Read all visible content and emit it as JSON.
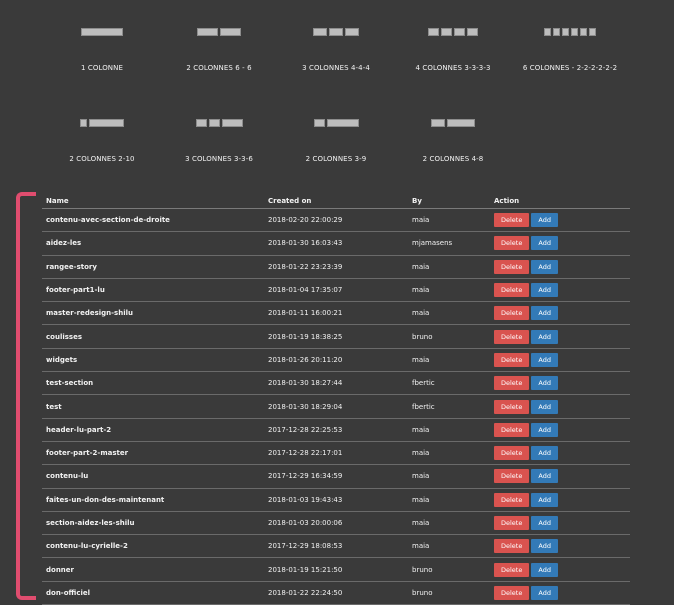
{
  "layouts": [
    {
      "label": "1 COLONNE",
      "parts": [
        1
      ]
    },
    {
      "label": "2 COLONNES 6 - 6",
      "parts": [
        1,
        1
      ]
    },
    {
      "label": "3 COLONNES 4-4-4",
      "parts": [
        1,
        1,
        1
      ]
    },
    {
      "label": "4 COLONNES 3-3-3-3",
      "parts": [
        1,
        1,
        1,
        1
      ]
    },
    {
      "label": "6 COLONNES - 2-2-2-2-2-2",
      "parts": [
        1,
        1,
        1,
        1,
        1,
        1
      ]
    },
    {
      "label": "2 COLONNES 2-10",
      "parts": [
        1,
        5
      ]
    },
    {
      "label": "3 COLONNES 3-3-6",
      "parts": [
        1,
        1,
        2
      ]
    },
    {
      "label": "2 COLONNES 3-9",
      "parts": [
        1,
        3
      ]
    },
    {
      "label": "2 COLONNES 4-8",
      "parts": [
        1,
        2
      ]
    }
  ],
  "table": {
    "headers": {
      "name": "Name",
      "created": "Created on",
      "by": "By",
      "action": "Action"
    },
    "delete_label": "Delete",
    "add_label": "Add",
    "rows": [
      {
        "name": "contenu-avec-section-de-droite",
        "created": "2018-02-20 22:00:29",
        "by": "maia"
      },
      {
        "name": "aidez-les",
        "created": "2018-01-30 16:03:43",
        "by": "mjamasens"
      },
      {
        "name": "rangee-story",
        "created": "2018-01-22 23:23:39",
        "by": "maia"
      },
      {
        "name": "footer-part1-lu",
        "created": "2018-01-04 17:35:07",
        "by": "maia"
      },
      {
        "name": "master-redesign-shilu",
        "created": "2018-01-11 16:00:21",
        "by": "maia"
      },
      {
        "name": "coulisses",
        "created": "2018-01-19 18:38:25",
        "by": "bruno"
      },
      {
        "name": "widgets",
        "created": "2018-01-26 20:11:20",
        "by": "maia"
      },
      {
        "name": "test-section",
        "created": "2018-01-30 18:27:44",
        "by": "fbertic"
      },
      {
        "name": "test",
        "created": "2018-01-30 18:29:04",
        "by": "fbertic"
      },
      {
        "name": "header-lu-part-2",
        "created": "2017-12-28 22:25:53",
        "by": "maia"
      },
      {
        "name": "footer-part-2-master",
        "created": "2017-12-28 22:17:01",
        "by": "maia"
      },
      {
        "name": "contenu-lu",
        "created": "2017-12-29 16:34:59",
        "by": "maia"
      },
      {
        "name": "faites-un-don-des-maintenant",
        "created": "2018-01-03 19:43:43",
        "by": "maia"
      },
      {
        "name": "section-aidez-les-shilu",
        "created": "2018-01-03 20:00:06",
        "by": "maia"
      },
      {
        "name": "contenu-lu-cyrielle-2",
        "created": "2017-12-29 18:08:53",
        "by": "maia"
      },
      {
        "name": "donner",
        "created": "2018-01-19 15:21:50",
        "by": "bruno"
      },
      {
        "name": "don-officiel",
        "created": "2018-01-22 22:24:50",
        "by": "bruno"
      }
    ]
  }
}
